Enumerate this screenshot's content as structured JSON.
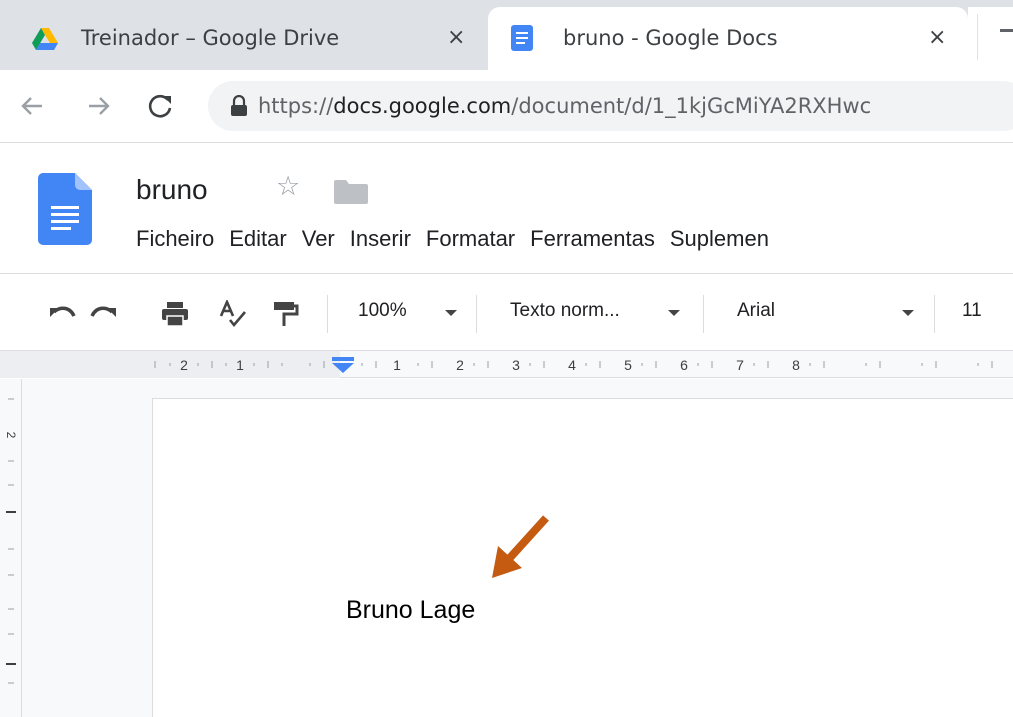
{
  "tabs": [
    {
      "title": "Treinador – Google Drive",
      "close": "×",
      "icon": "google-drive-icon",
      "active": false
    },
    {
      "title": "bruno - Google Docs",
      "close": "×",
      "icon": "google-docs-icon",
      "active": true
    }
  ],
  "address_bar": {
    "scheme": "https://",
    "host": "docs.google.com",
    "path": "/document/d/1_1kjGcMiYA2RXHwc"
  },
  "document": {
    "title": "bruno",
    "star": "☆"
  },
  "menu": [
    "Ficheiro",
    "Editar",
    "Ver",
    "Inserir",
    "Formatar",
    "Ferramentas",
    "Suplemen"
  ],
  "edit_toolbar": {
    "zoom": "100%",
    "style": "Texto norm...",
    "font": "Arial",
    "font_size": "11"
  },
  "ruler": {
    "labels": [
      "2",
      "1",
      "1",
      "2",
      "3",
      "4",
      "5",
      "6",
      "7",
      "8"
    ],
    "vertical_labels": [
      "2"
    ]
  },
  "content": {
    "text": "Bruno Lage"
  },
  "colors": {
    "tab_strip": "#dee1e6",
    "docs_blue": "#4285f4",
    "annotation_arrow": "#c55a11",
    "ruler_marker": "#4285f4"
  }
}
